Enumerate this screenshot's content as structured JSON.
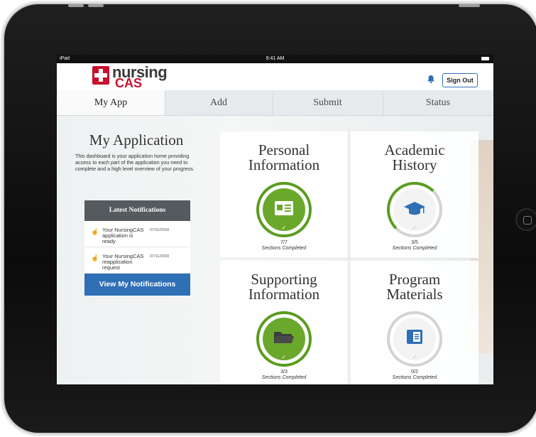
{
  "status_bar": {
    "carrier": "iPad",
    "time": "9:41 AM"
  },
  "header": {
    "logo_line1": "nursing",
    "logo_line2": "CAS",
    "sign_out_label": "Sign Out"
  },
  "tabs": [
    {
      "label": "My App"
    },
    {
      "label": "Add"
    },
    {
      "label": "Submit"
    },
    {
      "label": "Status"
    }
  ],
  "sidebar": {
    "title": "My Application",
    "intro": "This dashboard is your application home providing access to each part of the application you need to complete and a high level overview of your progress.",
    "notifications_header": "Latest Notifications",
    "notifications": [
      {
        "text": "Your NursingCAS application is ready",
        "date": "07/11/2018"
      },
      {
        "text": "Your NursingCAS reapplication request",
        "date": "07/11/2018"
      }
    ],
    "view_button_label": "View My Notifications"
  },
  "sections": [
    {
      "title_line1": "Personal",
      "title_line2": "Information",
      "count": "7/7",
      "label": "Sections Completed",
      "icon": "id-card-icon",
      "progress": 1.0
    },
    {
      "title_line1": "Academic",
      "title_line2": "History",
      "count": "3/5",
      "label": "Sections Completed",
      "icon": "graduation-cap-icon",
      "progress": 0.6
    },
    {
      "title_line1": "Supporting",
      "title_line2": "Information",
      "count": "3/3",
      "label": "Sections Completed",
      "icon": "folder-icon",
      "progress": 1.0
    },
    {
      "title_line1": "Program",
      "title_line2": "Materials",
      "count": "0/2",
      "label": "Sections Completed",
      "icon": "book-icon",
      "progress": 0.0
    }
  ],
  "colors": {
    "brand_red": "#c8102e",
    "green": "#6aa82c",
    "blue": "#2f6fb5"
  }
}
